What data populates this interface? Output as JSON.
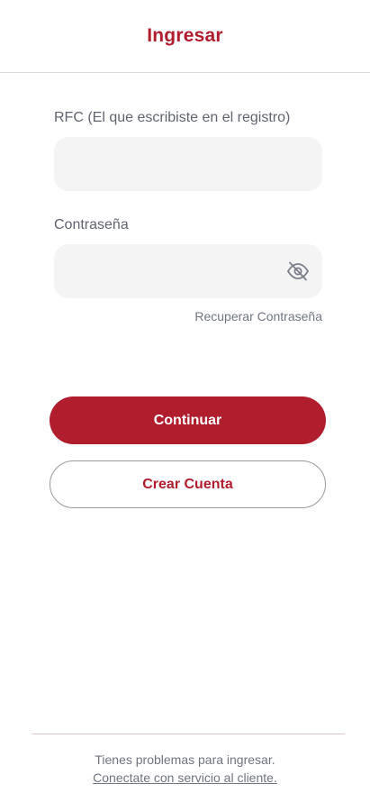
{
  "header": {
    "title": "Ingresar"
  },
  "form": {
    "rfc_label": "RFC (El que escribiste en el registro)",
    "rfc_value": "",
    "password_label": "Contraseña",
    "password_value": "",
    "toggle_icon": "eye-off-icon",
    "recover_link": "Recuperar Contraseña"
  },
  "actions": {
    "continue_label": "Continuar",
    "create_account_label": "Crear Cuenta"
  },
  "footer": {
    "problem_text": "Tienes problemas para ingresar.",
    "support_link": "Conectate con servicio al cliente."
  },
  "colors": {
    "brand": "#b01e2e",
    "field_bg": "#f4f4f5",
    "muted_text": "#6f7480"
  }
}
